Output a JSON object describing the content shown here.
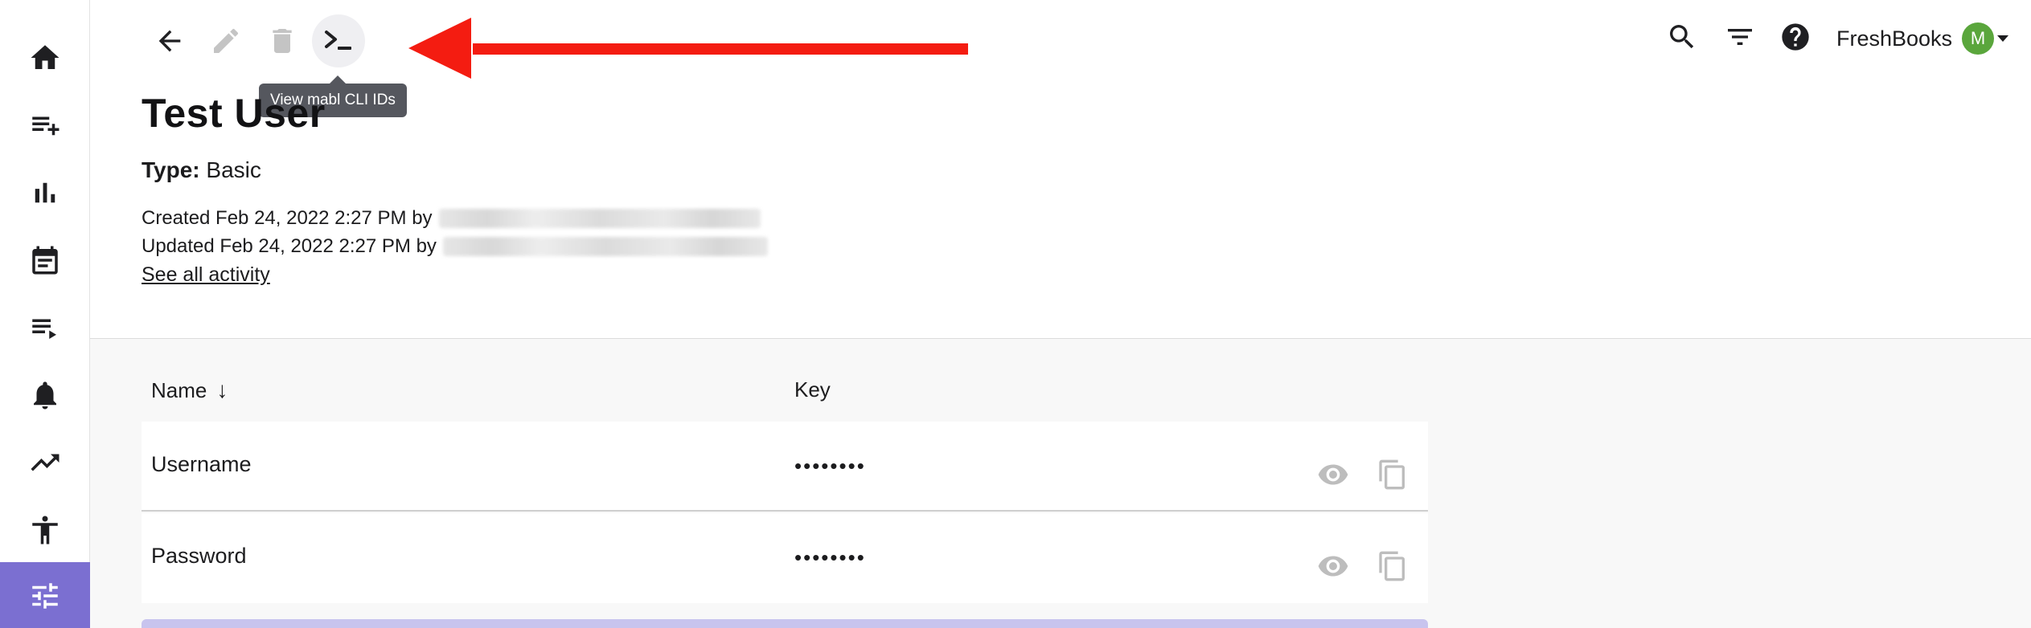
{
  "nav": {
    "items": [
      {
        "icon": "home-icon"
      },
      {
        "icon": "playlist-add-icon"
      },
      {
        "icon": "bar-chart-icon"
      },
      {
        "icon": "calendar-icon"
      },
      {
        "icon": "playlist-play-icon"
      },
      {
        "icon": "bell-icon"
      },
      {
        "icon": "trending-up-icon"
      },
      {
        "icon": "accessibility-icon"
      },
      {
        "icon": "sliders-icon",
        "active": true
      }
    ],
    "active_color": "#7b6fd1"
  },
  "toolbar": {
    "back_icon": "arrow-left-icon",
    "edit_icon": "pencil-icon",
    "delete_icon": "trash-icon",
    "cli_icon": "terminal-icon",
    "tooltip": "View mabl CLI IDs"
  },
  "header": {
    "search_icon": "search-icon",
    "filter_icon": "filter-icon",
    "help_icon": "help-icon",
    "account_name": "FreshBooks",
    "avatar_letter": "M",
    "avatar_color": "#5aa63c"
  },
  "credential": {
    "title": "Test User",
    "type_label": "Type:",
    "type_value": "Basic",
    "created": "Created Feb 24, 2022 2:27 PM by",
    "updated": "Updated Feb 24, 2022 2:27 PM by",
    "activity_link": "See all activity"
  },
  "table": {
    "columns": {
      "name": "Name",
      "sort_indicator": "↓",
      "key": "Key"
    },
    "rows": [
      {
        "name": "Username",
        "key": "••••••••"
      },
      {
        "name": "Password",
        "key": "••••••••"
      }
    ]
  },
  "colors": {
    "annotation_arrow": "#f41c11"
  }
}
